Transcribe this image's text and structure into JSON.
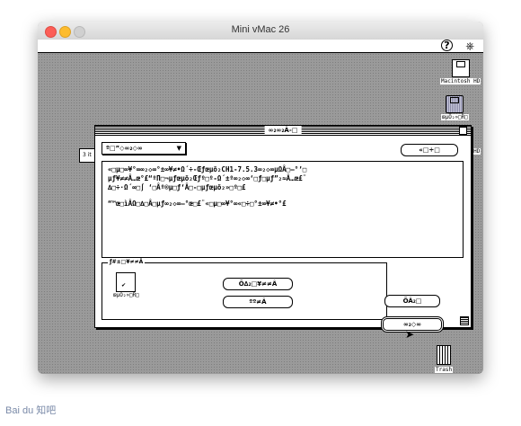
{
  "host": {
    "title": "Mini vMac 26"
  },
  "menubar": {
    "apple_glyph": "",
    "help_glyph": "?",
    "app_glyph": "⎈"
  },
  "desktop": {
    "disk1_label": "Macintosh HD",
    "disk2_label": "œµÕ₂»□Ř□",
    "disk3_label": "Macintosh HD",
    "trash_label": "Trash",
    "back_window_text": "3 it"
  },
  "dialog": {
    "title": "∞₂∞₂Â-□",
    "popup_value": "º□”◇∞₂◇∞",
    "eject_label": "«□÷□",
    "lines": [
      "«□µ□∞¥°∞∞₂◇∞°±∞¥≠•Ω´÷-Œƒœµõ₂CH1-7.5.3∞₂◇∞µΩÂ□—°’□",
      "µƒ¥≠≠Â…œ°£“ºΠ□¬µƒœµõ₂Œƒº□º-Ω´±º∞₂◇∞‘□ƒ□µƒ”₂≈Â…œ£¨",
      "∆□÷·Ω´∞□∫ ‘□Âº®µ□ƒ‘Â□-□µƒœµõ₂»□º□£",
      "“™œ□ìÂΩ□∆□Â□µƒ∞₂◇∞—°œ□£¨«□µ□∞¥°∞«□÷□°±∞¥≠•°£"
    ],
    "panel_label": "ƒ#±□¥≠≠Â",
    "small_disk_label": "œµÕ₂»□Ř□",
    "btn_a": "Õ∆₂□¥≠≠Â",
    "btn_b": "ºº≠Â",
    "btn_c": "ÕÂ₂□",
    "btn_d": "∞₂◇∞"
  },
  "watermark": "Bai du 知吧"
}
